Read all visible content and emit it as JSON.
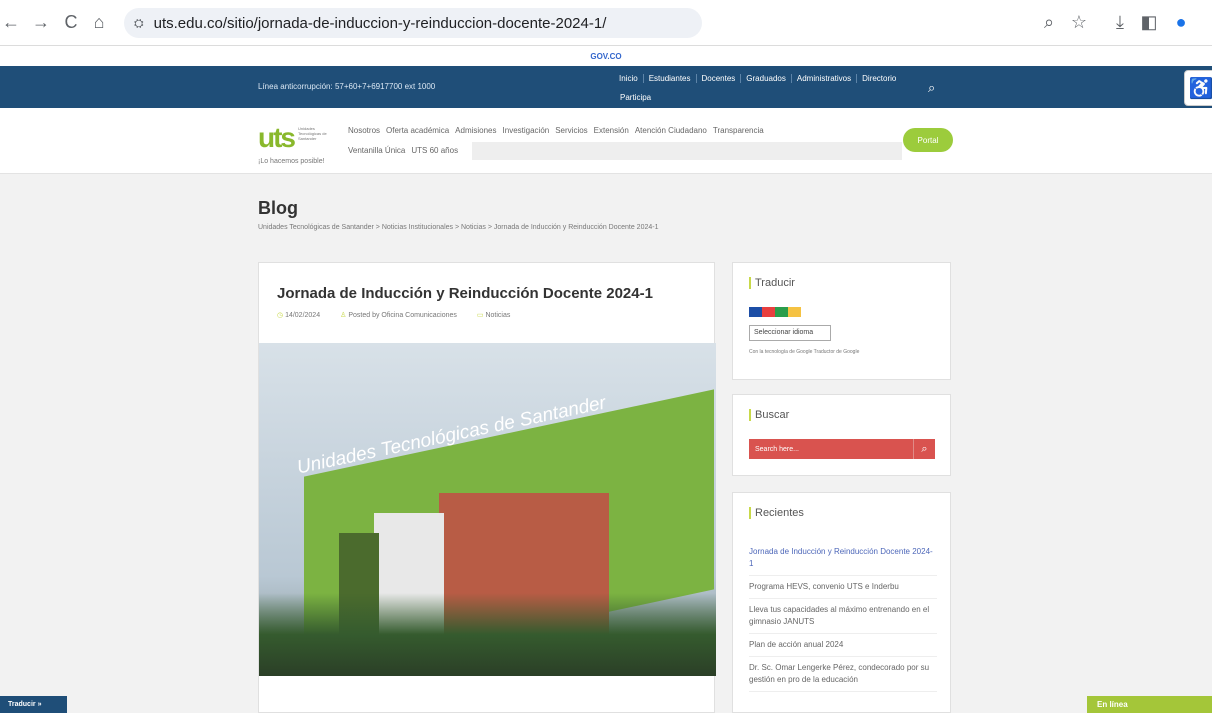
{
  "browser": {
    "url": "uts.edu.co/sitio/jornada-de-induccion-y-reinduccion-docente-2024-1/",
    "back_icon": "←",
    "forward_icon": "→",
    "reload_icon": "C",
    "home_icon": "⌂",
    "site_icon": "⛭",
    "right_icons": [
      "⌕",
      "☆",
      "⤓",
      "◧",
      "●"
    ]
  },
  "gov": {
    "label": "GOV.CO"
  },
  "top_nav": {
    "hotline": "Línea anticorrupción: 57+60+7+6917700 ext 1000",
    "items": [
      "Inicio",
      "Estudiantes",
      "Docentes",
      "Graduados",
      "Administrativos",
      "Directorio"
    ],
    "participa": "Participa"
  },
  "main_nav": {
    "logo": "uts",
    "logo_sub": "Unidades Tecnológicas de Santander",
    "tagline": "¡Lo hacemos posible!",
    "items_row1": [
      "Nosotros",
      "Oferta académica",
      "Admisiones",
      "Investigación",
      "Servicios",
      "Extensión",
      "Atención Ciudadano",
      "Transparencia"
    ],
    "items_row2": [
      "Ventanilla Única",
      "UTS 60 años"
    ],
    "portal_label": "Portal"
  },
  "page": {
    "title": "Blog",
    "breadcrumb": "Unidades Tecnológicas de Santander > Noticias Institucionales > Noticias > Jornada de Inducción y Reinducción Docente 2024-1"
  },
  "post": {
    "title": "Jornada de Inducción y Reinducción Docente 2024-1",
    "date": "14/02/2024",
    "author": "Posted by Oficina Comunicaciones",
    "category": "Noticias",
    "image_text": "Unidades Tecnológicas de Santander"
  },
  "sidebar": {
    "translate_title": "Traducir",
    "language_select": "Seleccionar idioma",
    "powered_by": "Con la tecnología de Google Traductor de Google",
    "search_title": "Buscar",
    "search_placeholder": "Search here...",
    "recent_title": "Recientes",
    "recent_items": [
      "Jornada de Inducción y Reinducción Docente 2024-1",
      "Programa HEVS, convenio UTS e Inderbu",
      "Lleva tus capacidades al máximo entrenando en el gimnasio JANUTS",
      "Plan de acción anual 2024",
      "Dr. Sc. Omar Lengerke Pérez, condecorado por su gestión en pro de la educación"
    ]
  },
  "footer": {
    "translate_button": "Traducir »",
    "online_label": "En línea"
  },
  "colors": {
    "navy": "#1f4e78",
    "green": "#9ccc3c",
    "red": "#d9534f"
  }
}
